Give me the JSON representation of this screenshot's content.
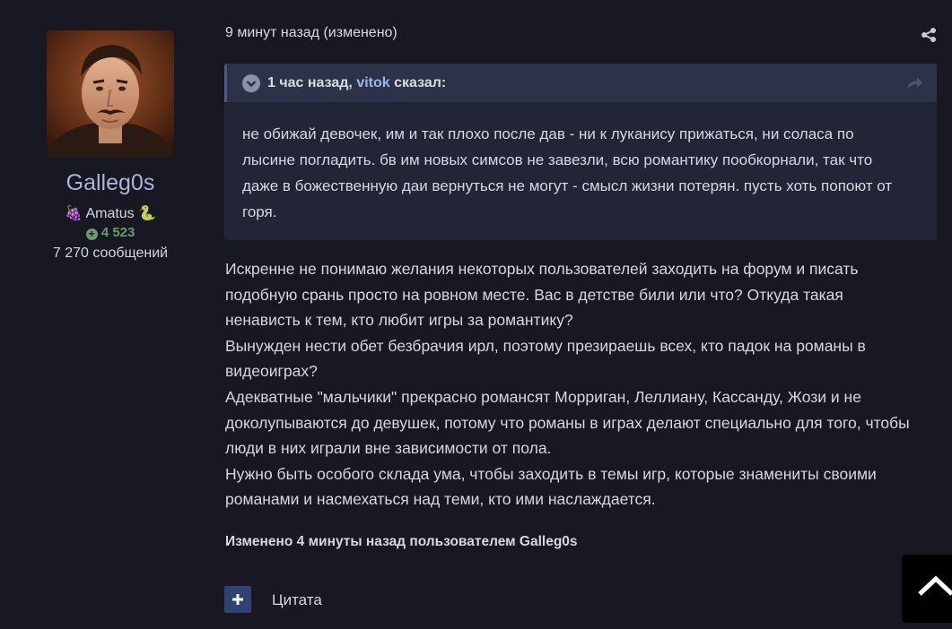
{
  "author": {
    "username": "Galleg0s",
    "rank": "🍇 Amatus 🐍",
    "reputation": "4 523",
    "posts_count": "7 270 сообщений"
  },
  "post": {
    "time": "9 минут назад (изменено)",
    "quote": {
      "prefix": "1 час назад,",
      "author": "vitok",
      "suffix": "сказал:",
      "text": "не обижай девочек, им и так плохо после дав - ни к луканису прижаться, ни соласа по лысине погладить. бв им новых симсов не завезли, всю романтику пообкорнали, так что даже в божественную даи вернуться не могут - смысл жизни потерян. пусть хоть попоют от горя."
    },
    "paragraphs": [
      "Искренне не понимаю желания некоторых пользователей заходить на форум и писать подобную срань просто на ровном месте. Вас в детстве били или что? Откуда такая ненависть к тем, кто любит игры за романтику?",
      "Вынужден нести обет безбрачия ирл, поэтому презираешь всех, кто падок на романы в видеоиграх?",
      "Адекватные \"мальчики\" прекрасно романсят Морриган, Леллиану, Кассанду, Жози и не доколупываются до девушек, потому что романы в играх делают специально для того, чтобы люди в них играли вне зависимости от пола.",
      "Нужно быть особого склада ума, чтобы заходить в темы игр, которые знамениты своими романами и насмехаться над теми, кто ими наслаждается."
    ],
    "edited_note": "Изменено 4 минуты назад пользователем Galleg0s"
  },
  "actions": {
    "quote_label": "Цитата"
  },
  "icons": {
    "share": "share-icon",
    "plus": "plus-icon",
    "chevron_up": "chevron-up-icon",
    "chevron_down": "chevron-down-icon",
    "reply_arrow": "reply-arrow-icon"
  },
  "colors": {
    "background": "#171822",
    "quote_bg": "#222536",
    "quote_header_bg": "#2c3349",
    "username": "#a9b6d6",
    "reputation": "#6c9a6c",
    "link": "#9fb4e6",
    "button": "#2f4270"
  }
}
